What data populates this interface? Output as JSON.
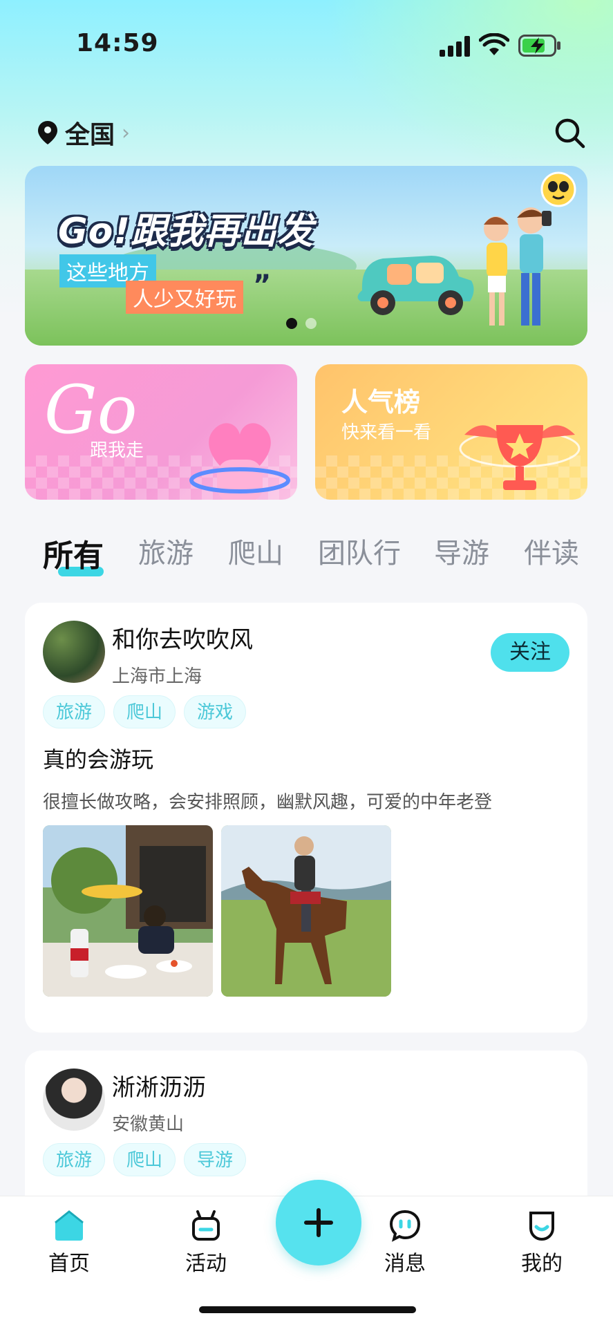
{
  "status_bar": {
    "time": "14:59"
  },
  "header": {
    "location": "全国"
  },
  "banner": {
    "title": "Go!跟我再出发",
    "tag_line_1": "这些地方",
    "tag_line_2": "人少又好玩",
    "quote_mark": "”",
    "page_count": 2,
    "active_page": 1
  },
  "cards": {
    "go": {
      "big_text": "Go",
      "sub_text": "跟我走"
    },
    "hot": {
      "title": "人气榜",
      "sub_text": "快来看一看"
    }
  },
  "tabs": [
    {
      "label": "所有",
      "active": true
    },
    {
      "label": "旅游"
    },
    {
      "label": "爬山"
    },
    {
      "label": "团队行"
    },
    {
      "label": "导游"
    },
    {
      "label": "伴读"
    }
  ],
  "posts": [
    {
      "user": "和你去吹吹风",
      "location": "上海市上海",
      "follow_label": "关注",
      "tags": [
        "旅游",
        "爬山",
        "游戏"
      ],
      "title": "真的会游玩",
      "description": "很擅长做攻略，会安排照顾，幽默风趣，可爱的中年老登"
    },
    {
      "user": "淅淅沥沥",
      "location": "安徽黄山",
      "tags": [
        "旅游",
        "爬山",
        "导游"
      ]
    }
  ],
  "bottom_nav": [
    {
      "label": "首页",
      "icon": "home-icon",
      "active": true
    },
    {
      "label": "活动",
      "icon": "activity-icon"
    },
    {
      "label": "消息",
      "icon": "message-icon"
    },
    {
      "label": "我的",
      "icon": "profile-icon"
    }
  ],
  "colors": {
    "accent": "#4fe0ec",
    "tag_text": "#4cc8d8",
    "go_card": "#ff9ad3",
    "hot_card": "#ffc36b"
  }
}
